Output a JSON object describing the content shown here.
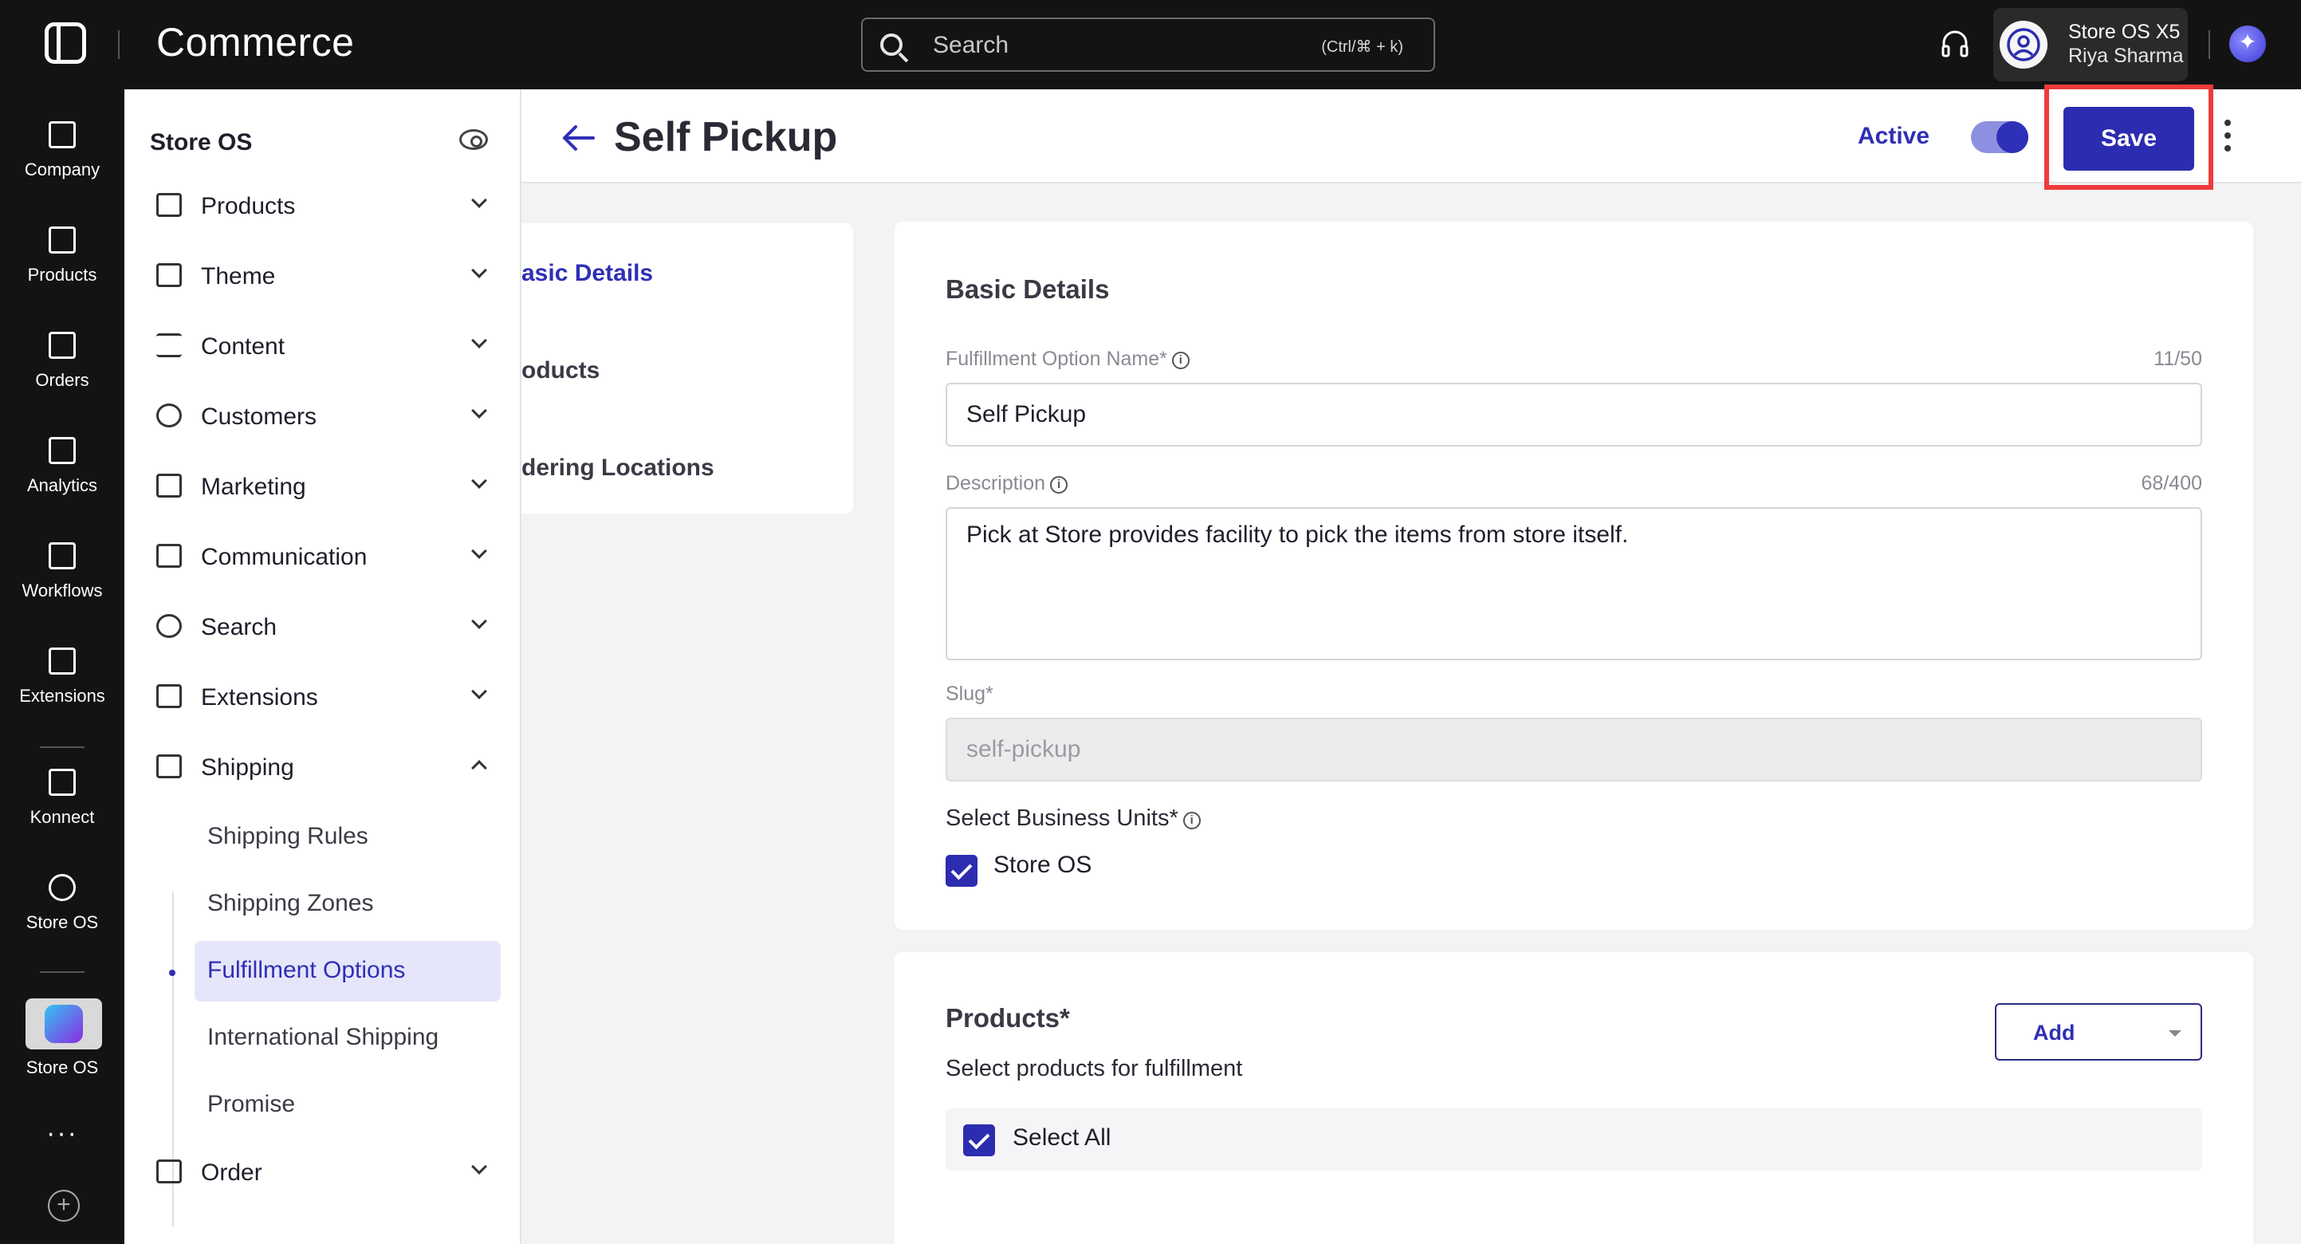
{
  "topbar": {
    "brand": "Commerce",
    "search_placeholder": "Search",
    "search_shortcut": "(Ctrl/⌘ + k)",
    "account_name": "Store OS X5",
    "account_user": "Riya Sharma",
    "ai_glyph": "✦"
  },
  "rail": {
    "items": [
      {
        "label": "Company",
        "icon": "building-icon"
      },
      {
        "label": "Products",
        "icon": "box-icon"
      },
      {
        "label": "Orders",
        "icon": "bag-icon"
      },
      {
        "label": "Analytics",
        "icon": "chart-icon"
      },
      {
        "label": "Workflows",
        "icon": "workflow-icon"
      },
      {
        "label": "Extensions",
        "icon": "puzzle-icon"
      },
      {
        "label": "Konnect",
        "icon": "konnect-icon"
      },
      {
        "label": "Store OS",
        "icon": "storeos-icon"
      },
      {
        "label": "Store OS",
        "icon": "storeos-app-icon"
      }
    ],
    "more": "···",
    "add": "+"
  },
  "sidebar": {
    "title": "Store OS",
    "items": [
      {
        "label": "Products"
      },
      {
        "label": "Theme"
      },
      {
        "label": "Content"
      },
      {
        "label": "Customers"
      },
      {
        "label": "Marketing"
      },
      {
        "label": "Communication"
      },
      {
        "label": "Search"
      },
      {
        "label": "Extensions"
      },
      {
        "label": "Shipping"
      },
      {
        "label": "Order"
      }
    ],
    "shipping_sub": [
      "Shipping Rules",
      "Shipping Zones",
      "Fulfillment Options",
      "International Shipping",
      "Promise"
    ]
  },
  "header": {
    "title": "Self Pickup",
    "active_label": "Active",
    "save_label": "Save"
  },
  "section_nav": [
    "asic Details",
    "oducts",
    "dering Locations"
  ],
  "basic_details": {
    "title": "Basic Details",
    "name_label": "Fulfillment Option Name*",
    "name_counter": "11/50",
    "name_value": "Self Pickup",
    "desc_label": "Description",
    "desc_counter": "68/400",
    "desc_value": "Pick at Store provides facility to pick the items from store itself.",
    "slug_label": "Slug*",
    "slug_value": "self-pickup",
    "bu_label": "Select Business Units*",
    "bu_option": "Store OS"
  },
  "products": {
    "title": "Products*",
    "subtitle": "Select products for fulfillment",
    "add_label": "Add",
    "select_all": "Select All"
  },
  "colors": {
    "accent": "#2c2cb0",
    "highlight": "#ee3b3b",
    "topbar": "#131313"
  }
}
